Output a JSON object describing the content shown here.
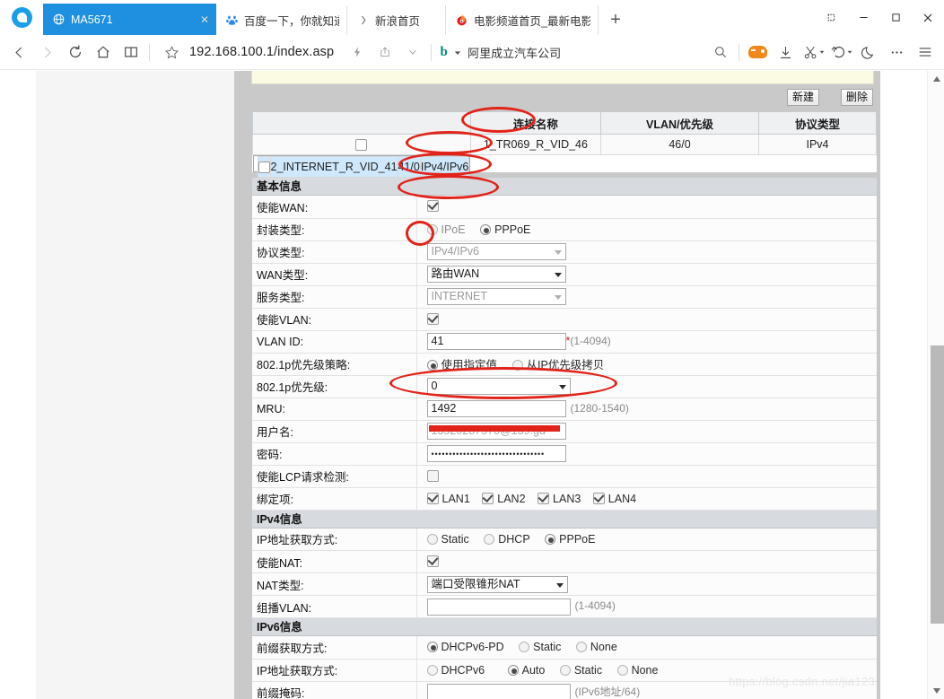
{
  "browser": {
    "tabs": [
      {
        "title": "MA5671",
        "icon": "globe-icon",
        "active": true,
        "close": "✕"
      },
      {
        "title": "百度一下，你就知道",
        "icon": "baidu-icon",
        "active": false
      },
      {
        "title": "新浪首页",
        "icon": "sina-icon",
        "active": false
      },
      {
        "title": "电影频道首页_最新电影资",
        "icon": "movie-icon",
        "active": false
      }
    ],
    "new_tab_label": "+",
    "window_controls": {
      "restore_down": "❐",
      "minimize": "—",
      "maximize": "□",
      "close": "✕"
    },
    "url": "192.168.100.1/index.asp",
    "search_engine_label": "阿里成立汽车公司",
    "search_engine_mark": "b"
  },
  "page": {
    "toolbar": {
      "new_button": "新建",
      "delete_button": "删除"
    },
    "connection_table": {
      "headers": [
        "",
        "连接名称",
        "VLAN/优先级",
        "协议类型"
      ],
      "rows": [
        {
          "selected": false,
          "name": "1_TR069_R_VID_46",
          "vlan": "46/0",
          "protocol": "IPv4"
        },
        {
          "selected": true,
          "name": "2_INTERNET_R_VID_41",
          "vlan": "41/0",
          "protocol": "IPv4/IPv6"
        }
      ]
    },
    "basic_section": {
      "title": "基本信息",
      "enable_wan": {
        "label": "使能WAN:",
        "checked": true
      },
      "encap_type": {
        "label": "封装类型:",
        "options": [
          "IPoE",
          "PPPoE"
        ],
        "selected": "PPPoE"
      },
      "protocol_type": {
        "label": "协议类型:",
        "value": "IPv4/IPv6",
        "disabled": true
      },
      "wan_type": {
        "label": "WAN类型:",
        "value": "路由WAN"
      },
      "service_type": {
        "label": "服务类型:",
        "value": "INTERNET",
        "disabled": true
      },
      "enable_vlan": {
        "label": "使能VLAN:",
        "checked": true
      },
      "vlan_id": {
        "label": "VLAN ID:",
        "value": "41",
        "hint": "(1-4094)",
        "required": "*"
      },
      "p8021p_policy": {
        "label": "802.1p优先级策略:",
        "options": [
          "使用指定值",
          "从IP优先级拷贝"
        ],
        "selected": "使用指定值"
      },
      "p8021p_priority": {
        "label": "802.1p优先级:",
        "value": "0"
      },
      "mru": {
        "label": "MRU:",
        "value": "1492",
        "hint": "(1280-1540)"
      },
      "username": {
        "label": "用户名:",
        "value": "13520287570@139.gd",
        "redacted": true
      },
      "password": {
        "label": "密码:",
        "value": "••••••••••••••••••••••••••••••••"
      },
      "enable_lcp": {
        "label": "使能LCP请求检测:",
        "checked": false
      },
      "bindings": {
        "label": "绑定项:",
        "items": [
          {
            "label": "LAN1",
            "checked": true
          },
          {
            "label": "LAN2",
            "checked": true
          },
          {
            "label": "LAN3",
            "checked": true
          },
          {
            "label": "LAN4",
            "checked": true
          }
        ]
      }
    },
    "ipv4_section": {
      "title": "IPv4信息",
      "ip_mode": {
        "label": "IP地址获取方式:",
        "options": [
          "Static",
          "DHCP",
          "PPPoE"
        ],
        "selected": "PPPoE"
      },
      "enable_nat": {
        "label": "使能NAT:",
        "checked": true
      },
      "nat_type": {
        "label": "NAT类型:",
        "value": "端口受限锥形NAT"
      },
      "multicast_vlan": {
        "label": "组播VLAN:",
        "value": "",
        "hint": "(1-4094)"
      }
    },
    "ipv6_section": {
      "title": "IPv6信息",
      "prefix_mode": {
        "label": "前缀获取方式:",
        "options": [
          "DHCPv6-PD",
          "Static",
          "None"
        ],
        "selected": "DHCPv6-PD"
      },
      "ip_mode": {
        "label": "IP地址获取方式:",
        "options": [
          "DHCPv6",
          "Auto",
          "Static",
          "None"
        ],
        "selected": "Auto"
      },
      "prefix_mask": {
        "label": "前缀掩码:",
        "value": "",
        "hint": "(IPv6地址/64)"
      }
    },
    "watermark": "https://blog.csdn.net/jia123"
  }
}
